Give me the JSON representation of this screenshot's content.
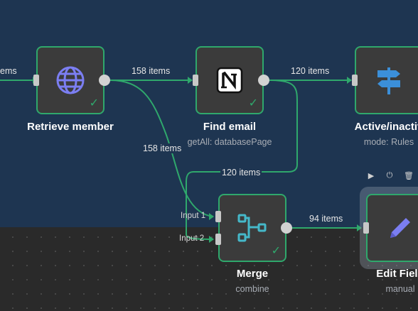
{
  "canvas": {
    "sticky_color": "#1e3551",
    "edge_color": "#2fa86c"
  },
  "edges": {
    "left_items": "ems",
    "retrieve_to_find": "158 items",
    "find_to_active": "120 items",
    "retrieve_to_merge": "158 items",
    "find_to_merge": "120 items",
    "merge_to_edit": "94 items"
  },
  "nodes": {
    "retrieve": {
      "title": "Retrieve member",
      "icon": "globe-icon"
    },
    "find": {
      "title": "Find email",
      "subtitle": "getAll: databasePage",
      "icon": "notion-icon"
    },
    "active": {
      "title": "Active/inactiv",
      "subtitle": "mode: Rules",
      "icon": "signpost-icon"
    },
    "merge": {
      "title": "Merge",
      "subtitle": "combine",
      "icon": "merge-icon",
      "input1": "Input 1",
      "input2": "Input 2"
    },
    "edit": {
      "title": "Edit Field",
      "subtitle": "manual",
      "icon": "pencil-icon"
    }
  },
  "toolbar": {
    "play": "▶",
    "power": "⏻",
    "delete": "🗑"
  }
}
